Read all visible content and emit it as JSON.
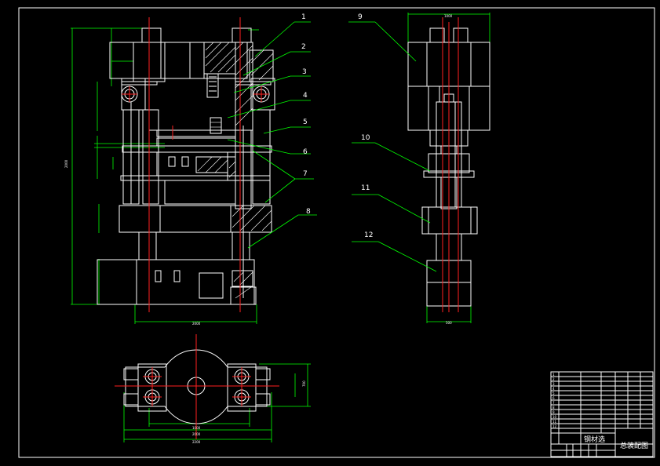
{
  "callouts": [
    "1",
    "2",
    "3",
    "4",
    "5",
    "6",
    "7",
    "8",
    "9",
    "10",
    "11",
    "12"
  ],
  "title_block": {
    "name_cell": "钢材选",
    "drawing_title": "总装配图"
  },
  "colors": {
    "background": "#000000",
    "outline": "#ffffff",
    "dimension": "#00ff00",
    "centerline": "#ff2020",
    "frame": "#ffffff"
  }
}
